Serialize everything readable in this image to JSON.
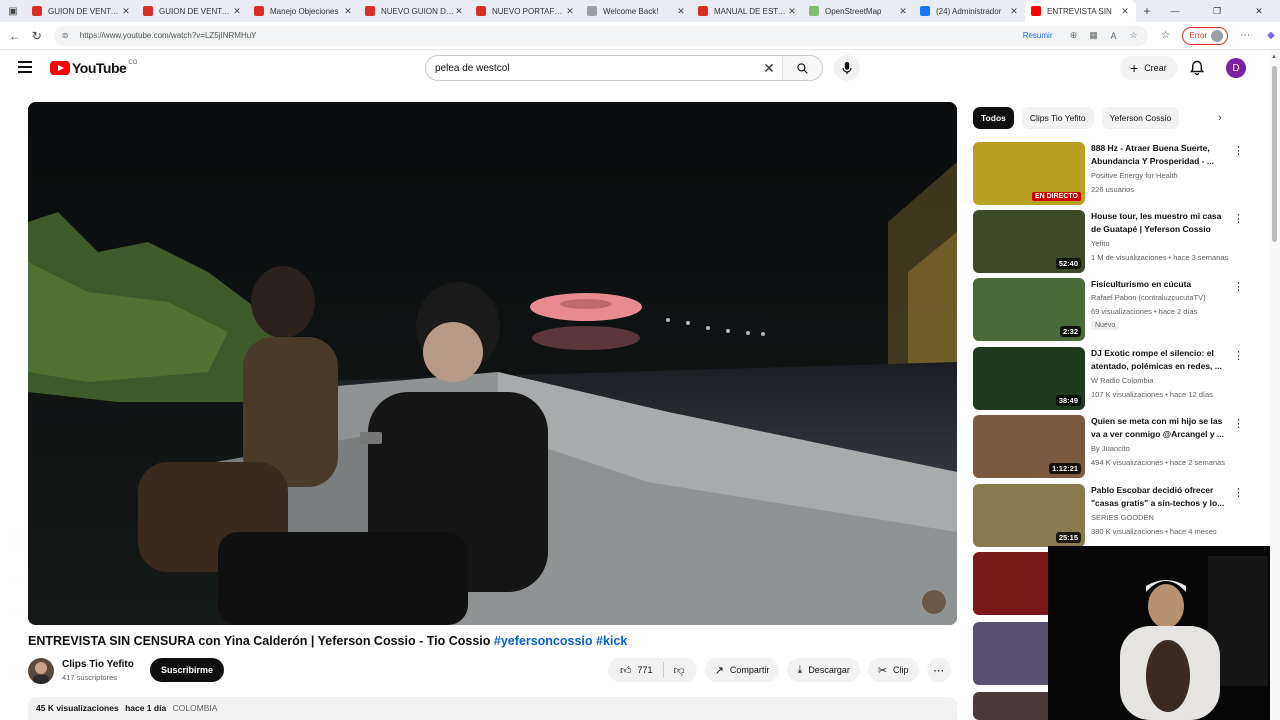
{
  "browser": {
    "tabs": [
      {
        "label": "GUION DE VENTA DE",
        "color": "#d93025"
      },
      {
        "label": "GUION DE VENTA DE",
        "color": "#d93025"
      },
      {
        "label": "Manejo Objeciones",
        "color": "#d93025"
      },
      {
        "label": "NUEVO GUION DE VE",
        "color": "#d93025"
      },
      {
        "label": "NUEVO PORTAFOLIO",
        "color": "#d93025"
      },
      {
        "label": "Welcome Back!",
        "color": "#9aa0a6"
      },
      {
        "label": "MANUAL DE ESTADO",
        "color": "#d93025"
      },
      {
        "label": "OpenStreetMap",
        "color": "#7ebc6f"
      },
      {
        "label": "(24) Administrador",
        "color": "#1877f2"
      },
      {
        "label": "ENTREVISTA SIN",
        "color": "#ff0000"
      }
    ],
    "url": "https://www.youtube.com/watch?v=LZ5jINRMHuY",
    "resumir": "Resumir",
    "error_label": "Error"
  },
  "youtube": {
    "logo": "YouTube",
    "country_code": "CO",
    "search_value": "pelea de westcol",
    "create_label": "Crear",
    "avatar_letter": "D"
  },
  "video": {
    "title": "ENTREVISTA SIN CENSURA con Yina Calderón | Yeferson Cossio - Tio Cossio",
    "hashtag1": "#yefersoncossio",
    "hashtag2": "#kick",
    "channel": "Clips Tio Yefito",
    "subscribers": "417 suscriptores",
    "subscribe_label": "Suscribirme",
    "likes": "771",
    "share_label": "Compartir",
    "download_label": "Descargar",
    "clip_label": "Clip",
    "views": "45 K visualizaciones",
    "date": "hace 1 día",
    "country": "COLOMBIA"
  },
  "sidebar": {
    "chips": [
      "Todos",
      "Clips Tio Yefito",
      "Yeferson Cossio"
    ],
    "recommendations": [
      {
        "title": "888 Hz - Atraer Buena Suerte, Abundancia Y Prosperidad - ...",
        "channel": "Positive Energy for Health",
        "meta": "226 usuarios",
        "badge": "EN DIRECTO",
        "duration": "",
        "thumb": "#b8a020"
      },
      {
        "title": "House tour, les muestro mi casa de Guatapé | Yeferson Cossio",
        "channel": "Yefito",
        "meta": "1 M de visualizaciones • hace 3 semanas",
        "badge": "",
        "duration": "52:40",
        "thumb": "#3c4a2a"
      },
      {
        "title": "Fisiculturismo en cúcuta",
        "channel": "Rafael Pabon (contraluzcucutaTV)",
        "meta": "69 visualizaciones • hace 2 días",
        "badge": "Nuevo",
        "duration": "2:32",
        "thumb": "#4a6a3a"
      },
      {
        "title": "DJ Exotic rompe el silencio: el atentado, polémicas en redes, ...",
        "channel": "W Radio Colombia",
        "meta": "107 K visualizaciones • hace 12 días",
        "badge": "",
        "duration": "38:49",
        "thumb": "#1f3a1f"
      },
      {
        "title": "Quien se meta con mi hijo se las va a ver conmigo @Arcangel y ...",
        "channel": "By Juancito",
        "meta": "494 K visualizaciones • hace 2 semanas",
        "badge": "",
        "duration": "1:12:21",
        "thumb": "#7a5a40"
      },
      {
        "title": "Pablo Escobar decidió ofrecer \"casas gratis\" a sin-techos y lo...",
        "channel": "SERIES GOODEN",
        "meta": "380 K visualizaciones • hace 4 meses",
        "badge": "",
        "duration": "25:15",
        "thumb": "#8a7a50"
      }
    ]
  },
  "colors": {
    "accent": "#065fd4",
    "brand": "#ff0000"
  }
}
